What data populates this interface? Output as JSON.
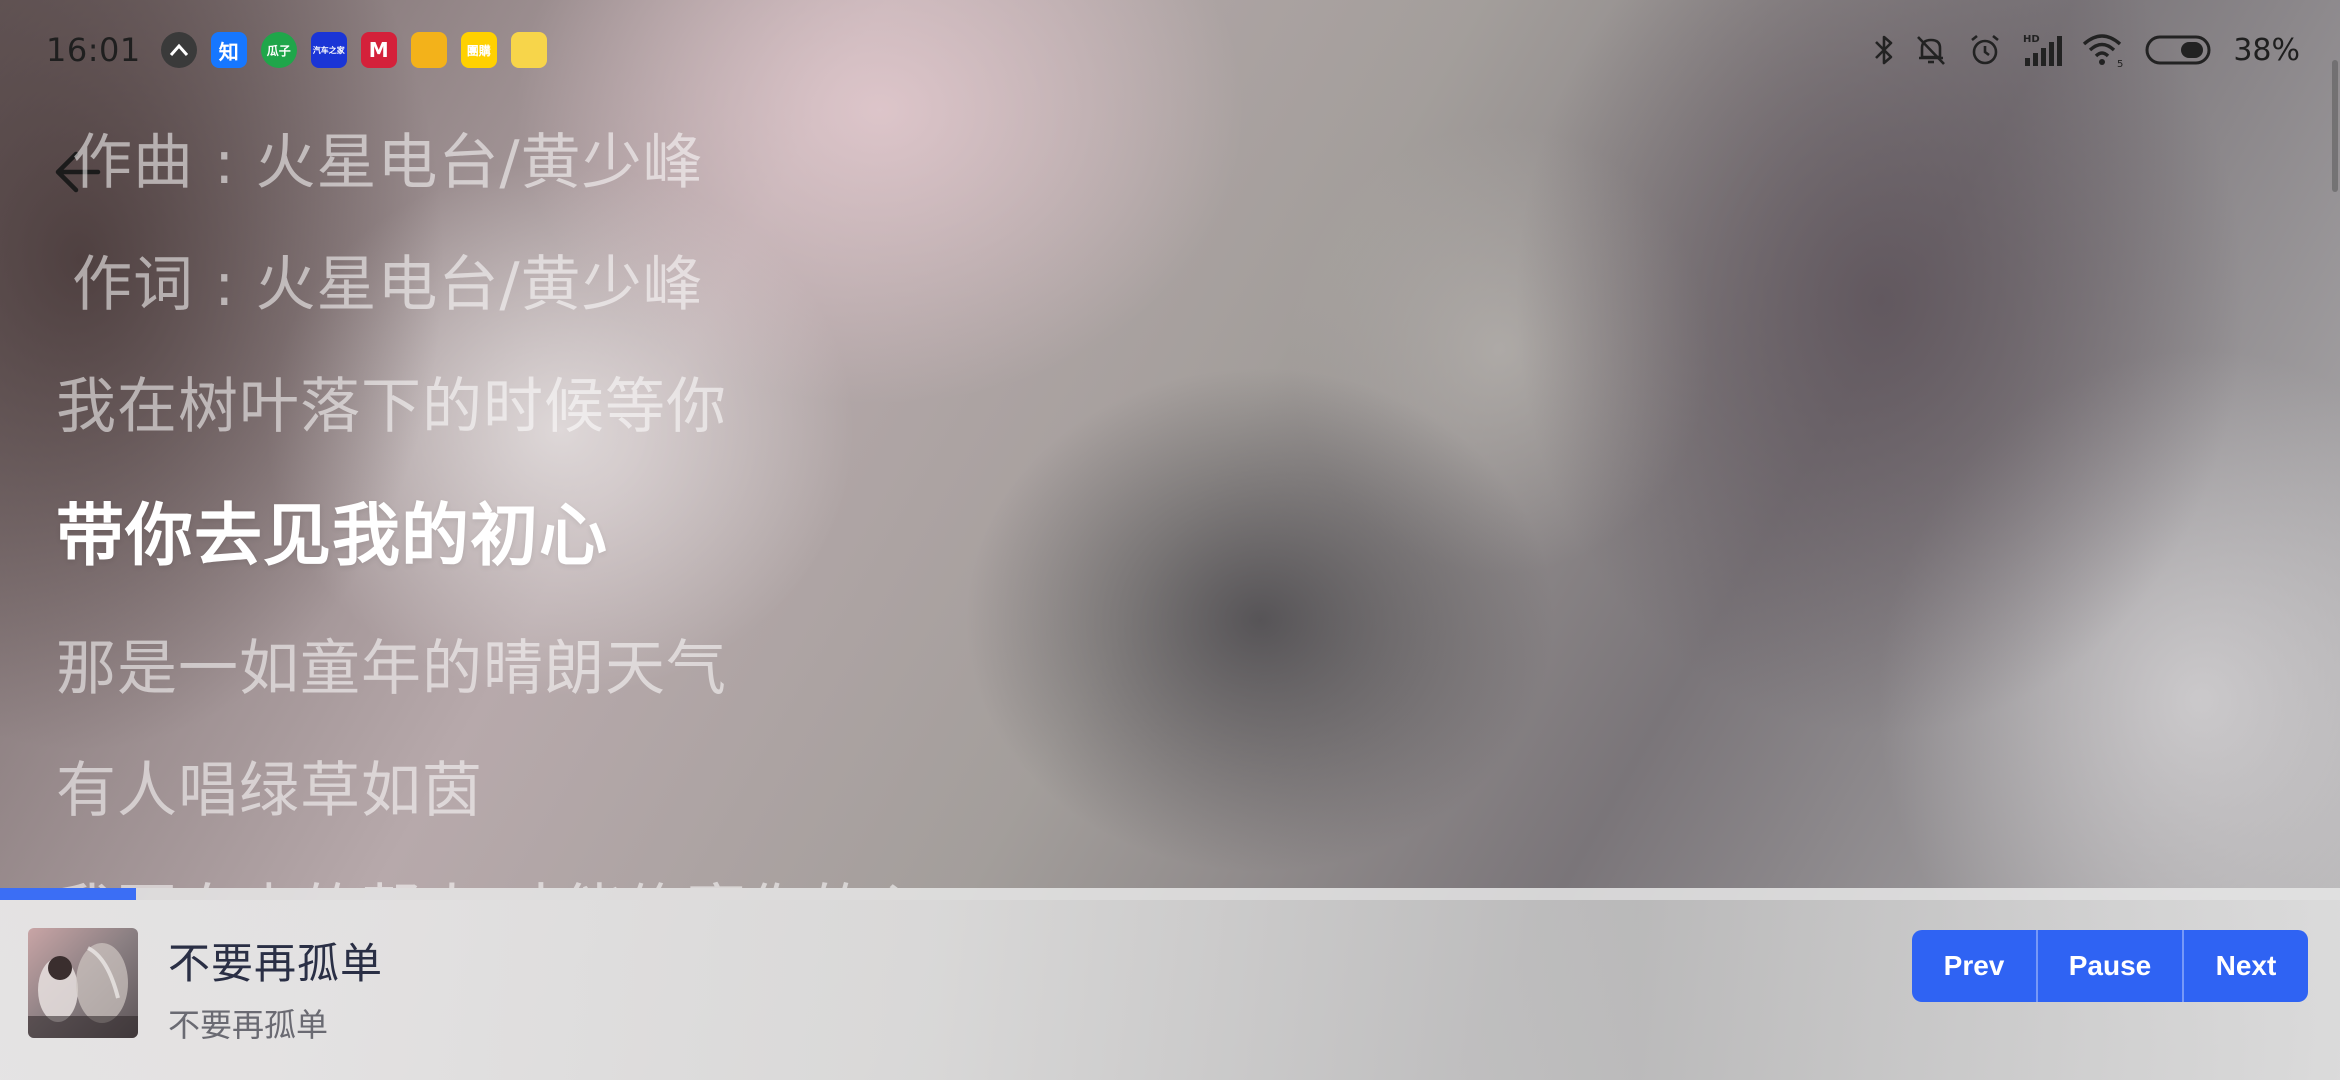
{
  "status_bar": {
    "time": "16:01",
    "notification_icons": [
      {
        "name": "caret-up-icon",
        "color": "#3a3a3a",
        "label": "",
        "round": true
      },
      {
        "name": "zhihu-icon",
        "color": "#1677ff",
        "label": "知",
        "round": false
      },
      {
        "name": "guazi-icon",
        "color": "#1fa64a",
        "label": "瓜子",
        "round": true
      },
      {
        "name": "autohome-icon",
        "color": "#1a35d6",
        "label": "汽车之家",
        "round": false
      },
      {
        "name": "cmb-icon",
        "color": "#d4213a",
        "label": "M",
        "round": false
      },
      {
        "name": "app-yellow-icon",
        "color": "#f3b21a",
        "label": "",
        "round": false
      },
      {
        "name": "meituan-icon",
        "color": "#ffd100",
        "label": "團購",
        "round": false
      },
      {
        "name": "fruit-app-icon",
        "color": "#f7d54a",
        "label": "",
        "round": false
      }
    ],
    "battery": "38%"
  },
  "lyrics": {
    "lines": [
      "作曲 : 火星电台/黄少峰",
      "作词 : 火星电台/黄少峰",
      "我在树叶落下的时候等你",
      "带你去见我的初心",
      "那是一如童年的晴朗天气",
      "有人唱绿草如茵",
      "我要自由的帮人 才能修赛你的心"
    ],
    "active_index": 3
  },
  "progress": {
    "fraction": 0.058,
    "accent": "#3b6ef5"
  },
  "player": {
    "title": "不要再孤单",
    "artist": "不要再孤单",
    "cover_icon": "album-cover-image",
    "prev_label": "Prev",
    "pause_label": "Pause",
    "next_label": "Next",
    "button_color": "#2f63f3"
  }
}
